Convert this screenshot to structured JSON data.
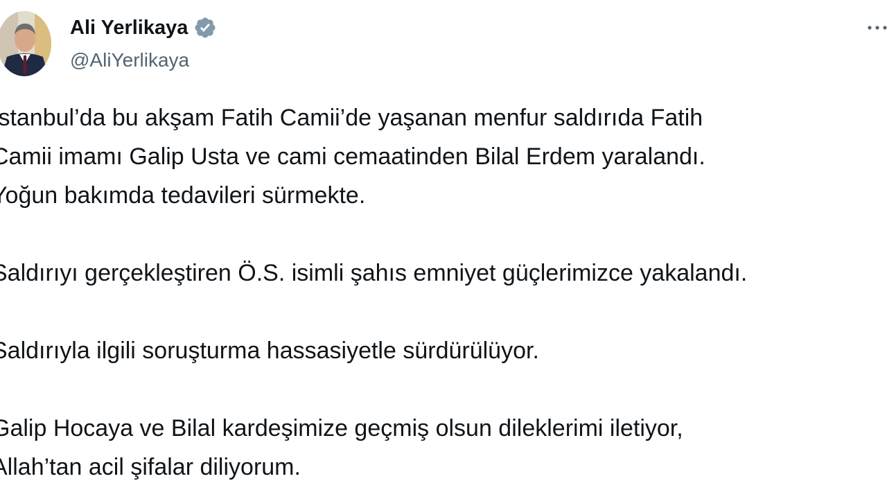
{
  "author": {
    "name": "Ali Yerlikaya",
    "handle": "@AliYerlikaya",
    "verified_color": "#829aab"
  },
  "tweet": {
    "paragraphs": [
      [
        "İstanbul’da bu akşam Fatih Camii’de yaşanan menfur saldırıda Fatih",
        "Camii imamı Galip Usta ve cami cemaatinden Bilal Erdem yaralandı.",
        "Yoğun bakımda tedavileri sürmekte."
      ],
      [
        "Saldırıyı gerçekleştiren Ö.S. isimli şahıs emniyet güçlerimizce yakalandı."
      ],
      [
        "Saldırıyla ilgili soruşturma hassasiyetle sürdürülüyor."
      ],
      [
        "Galip Hocaya ve Bilal kardeşimize geçmiş olsun dileklerimi iletiyor,",
        "Allah’tan acil şifalar diliyorum."
      ]
    ]
  },
  "icons": {
    "verified": "verified-badge-icon",
    "more": "more-options-icon"
  }
}
